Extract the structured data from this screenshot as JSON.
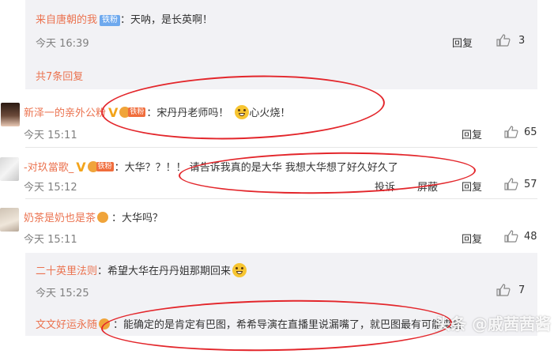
{
  "top_reply": {
    "name": "来自唐朝的我",
    "badge": "铁粉",
    "text": "：天呐，是长英啊！",
    "time": "今天 16:39",
    "reply_label": "回复",
    "likes": "3"
  },
  "more_replies": "共7条回复",
  "comments": [
    {
      "name": "新泽一的亲外公粉",
      "fan_label": "铁粉",
      "text": "：宋丹丹老师吗！",
      "text2": "心火烧！",
      "time": "今天 15:11",
      "reply_label": "回复",
      "likes": "65"
    },
    {
      "name": "-对玖當歌_",
      "fan_label": "铁粉",
      "text": "：大华？？！！ 请告诉我真的是大华 我想大华想了好久好久了",
      "time": "今天 15:12",
      "report_label": "投诉",
      "block_label": "屏蔽",
      "reply_label": "回复",
      "likes": "57"
    },
    {
      "name": "奶茶是奶也是茶",
      "text": "：大华吗？",
      "time": "今天 15:11",
      "reply_label": "回复",
      "likes": "48"
    }
  ],
  "sub_replies": [
    {
      "name": "二十英里法则",
      "text": "：希望大华在丹丹姐那期回来",
      "time": "今天 15:25",
      "likes": "7"
    },
    {
      "name": "文文好运永随",
      "text": "：能确定的是肯定有巴图，希希导演在直播里说漏嘴了，就巴图最有可能来着"
    }
  ],
  "watermark": "头条 @戚茜茜酱",
  "colors": {
    "name": "#eb7350",
    "annotation": "#e3262b",
    "reply_bg": "#f2f2f5"
  }
}
